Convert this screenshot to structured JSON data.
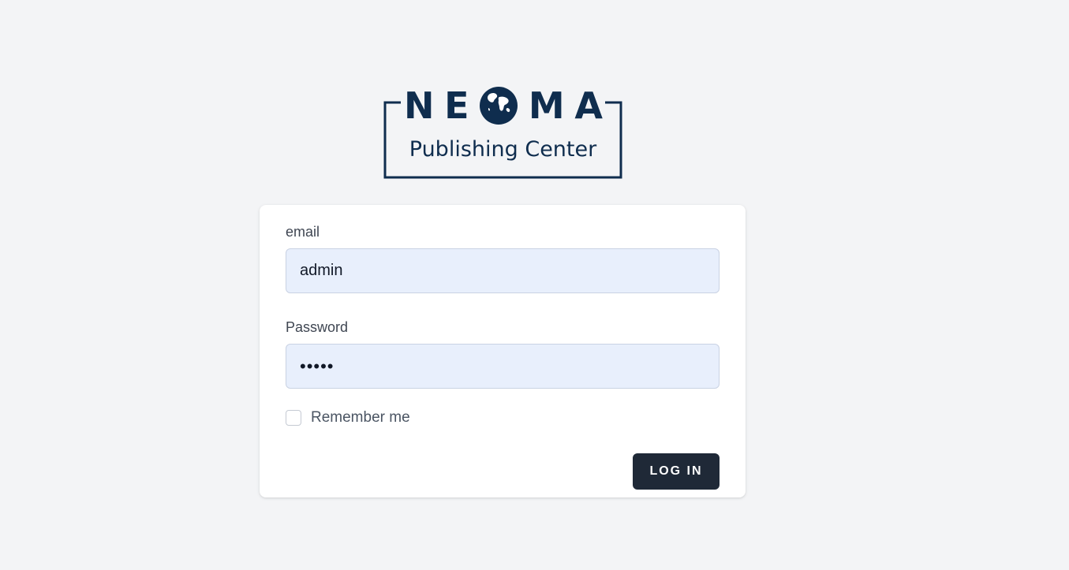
{
  "logo": {
    "letters": [
      "N",
      "E",
      "M",
      "A"
    ],
    "subtitle": "Publishing Center",
    "color": "#0f2d4e"
  },
  "form": {
    "email_label": "email",
    "email_value": "admin",
    "password_label": "Password",
    "password_value": "•••••",
    "remember_label": "Remember me",
    "remember_checked": false,
    "login_label": "LOG IN"
  },
  "colors": {
    "background": "#f3f4f6",
    "card": "#ffffff",
    "input_bg": "#e8effc",
    "button_bg": "#1f2937",
    "button_text": "#ffffff"
  }
}
